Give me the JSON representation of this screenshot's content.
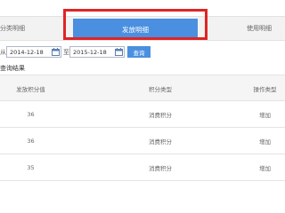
{
  "tabs": {
    "left_label": "分类明细",
    "active_label": "发放明细",
    "right_label": "使用明细"
  },
  "filter": {
    "from_label": "从",
    "start_date": "2014-12-18",
    "to_label": "至",
    "end_date": "2015-12-18",
    "search_label": "查询"
  },
  "results": {
    "title": "查询结果",
    "headers": [
      "发放积分值",
      "积分类型",
      "操作类型"
    ],
    "rows": [
      [
        "36",
        "消费积分",
        "增加"
      ],
      [
        "36",
        "消费积分",
        "增加"
      ],
      [
        "35",
        "消费积分",
        "增加"
      ]
    ]
  },
  "colors": {
    "accent": "#4a8fe0",
    "highlight": "#e02424"
  }
}
